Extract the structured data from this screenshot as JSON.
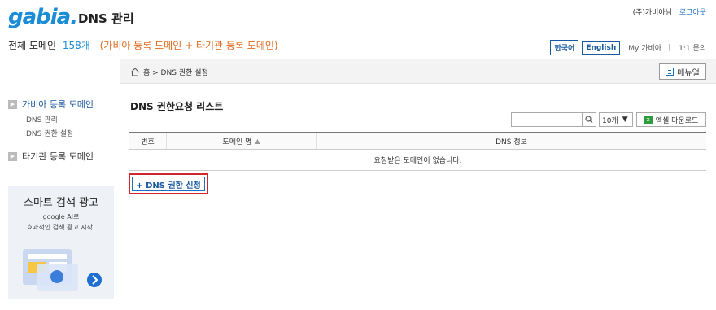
{
  "header": {
    "logo": "gabia.",
    "app_title": "DNS 관리",
    "company": "(주)가비아님",
    "logout": "로그아웃"
  },
  "summary": {
    "label": "전체 도메인",
    "count": "158개",
    "note": "(가비아 등록 도메인 + 타기관 등록 도메인)"
  },
  "lang_bar": {
    "korean": "한국어",
    "english": "English",
    "my_gabia": "My 가비아",
    "separator": "|",
    "inquiry": "1:1 문의"
  },
  "breadcrumb": {
    "text": "홈 > DNS 권한 설정",
    "menu_button": "메뉴얼"
  },
  "sidebar": {
    "group1": "가비아 등록 도메인",
    "group1_items": [
      "DNS 관리",
      "DNS 권한 설정"
    ],
    "group2": "타기관 등록 도메인"
  },
  "ad": {
    "title": "스마트 검색 광고",
    "line1": "google AI로",
    "line2": "효과적인 검색 광고 시작!"
  },
  "content": {
    "title": "DNS 권한요청 리스트",
    "per_page": "10개",
    "excel_button": "엑셀 다운로드",
    "table_headers": [
      "번호",
      "도메인 명",
      "DNS 정보"
    ],
    "empty_message": "요청받은 도메인이 없습니다.",
    "request_button": "+ DNS 권한 신청"
  },
  "colors": {
    "brand": "#1a8dd6",
    "accent_orange": "#e06b1f",
    "highlight_red": "#d1262e"
  },
  "icons": [
    "home-icon",
    "search-icon",
    "chevron-down-icon",
    "excel-icon",
    "menu-icon",
    "sort-icon",
    "arrow-right-icon"
  ]
}
